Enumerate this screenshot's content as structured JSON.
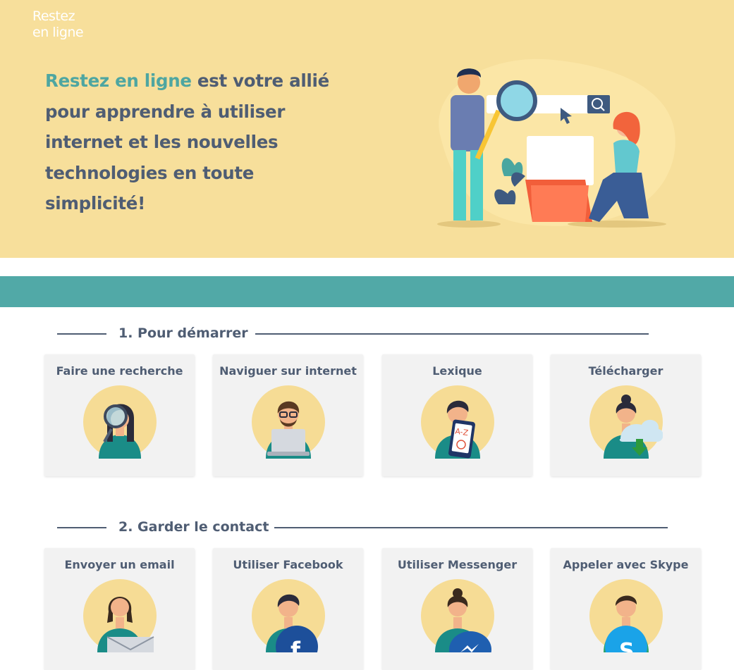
{
  "header": {
    "logo_line1": "Restez",
    "logo_line2": "en ligne",
    "tagline_accent": "Restez en ligne",
    "tagline_rest": " est votre allié pour apprendre à utiliser internet et les nouvelles technologies en toute simplicité!"
  },
  "sections": [
    {
      "title": "1. Pour démarrer",
      "cards": [
        {
          "label": "Faire une recherche",
          "icon": "woman-magnifier-icon"
        },
        {
          "label": "Naviguer sur internet",
          "icon": "man-laptop-icon"
        },
        {
          "label": "Lexique",
          "icon": "man-tablet-az-icon"
        },
        {
          "label": "Télécharger",
          "icon": "woman-cloud-download-icon"
        }
      ]
    },
    {
      "title": "2. Garder le contact",
      "cards": [
        {
          "label": "Envoyer un email",
          "icon": "woman-envelope-icon"
        },
        {
          "label": "Utiliser Facebook",
          "icon": "man-facebook-icon"
        },
        {
          "label": "Utiliser Messenger",
          "icon": "woman-messenger-icon"
        },
        {
          "label": "Appeler avec Skype",
          "icon": "man-skype-icon"
        }
      ]
    }
  ],
  "colors": {
    "hero_bg": "#f7df9b",
    "accent": "#4ea6a1",
    "band": "#51a9a7",
    "text": "#4f5d73",
    "card_bg": "#f2f2f2",
    "avatar_circle": "#f6dc95"
  }
}
